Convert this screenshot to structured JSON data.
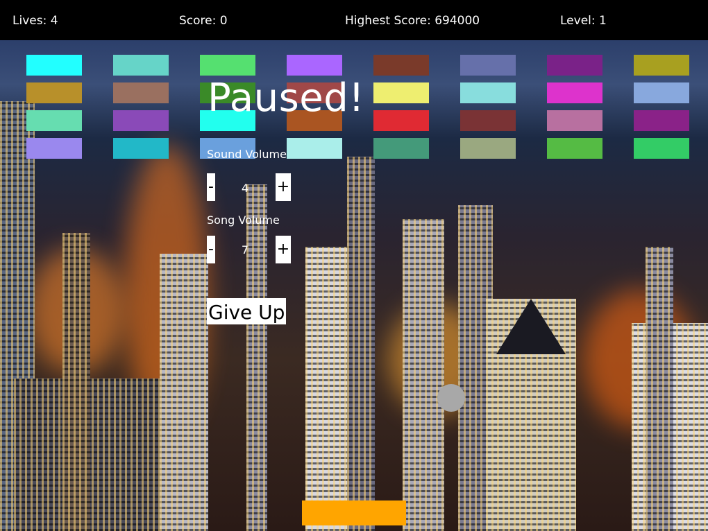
{
  "hud": {
    "lives_label": "Lives: 4",
    "score_label": "Score: 0",
    "highscore_label": "Highest Score: 694000",
    "level_label": "Level: 1"
  },
  "bricks": [
    [
      "#22ffff",
      "#66d4c8",
      "#55e070",
      "#aa66ff",
      "#7a3a2a",
      "#6670aa",
      "#7a2288",
      "#a8a020"
    ],
    [
      "#b8902a",
      "#9a7060",
      "#3a8a28",
      "#a04848",
      "#eeee70",
      "#88dddd",
      "#dd33cc",
      "#88a8dd"
    ],
    [
      "#66ddb0",
      "#8a4ab8",
      "#22ffee",
      "#aa5522",
      "#e02a33",
      "#7a3335",
      "#b870a0",
      "#8a2288"
    ],
    [
      "#9a88ee",
      "#22b8c8",
      "#6aa0dd",
      "#aaeeea",
      "#449a7a",
      "#9aa880",
      "#55bb44",
      "#33cc66"
    ]
  ],
  "pause_menu": {
    "title": "Paused!",
    "sound_volume_label": "Sound Volume",
    "sound_volume_value": "4",
    "song_volume_label": "Song Volume",
    "song_volume_value": "7",
    "minus_label": "-",
    "plus_label": "+",
    "give_up_label": "Give Up"
  },
  "colors": {
    "paddle": "#ffa500",
    "ball": "#a8a8a8",
    "hud_background": "#000000"
  }
}
